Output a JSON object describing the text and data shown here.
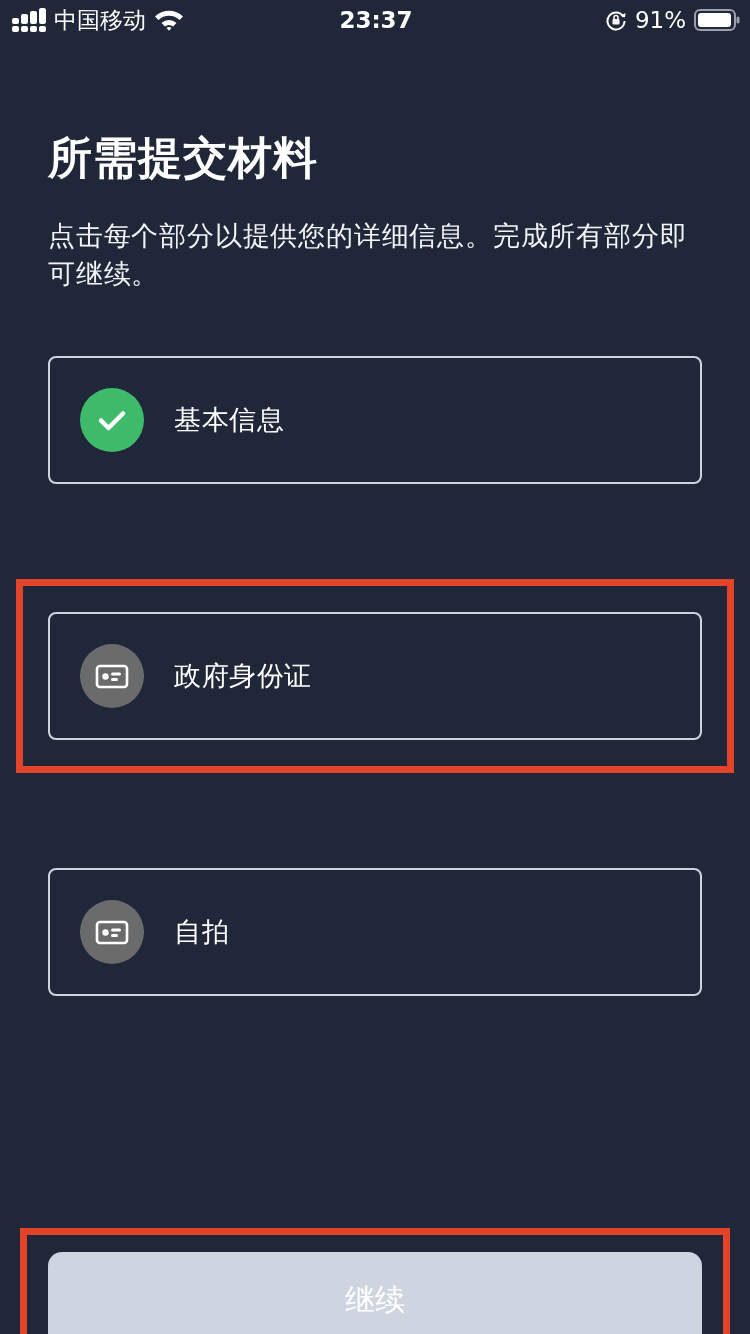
{
  "status_bar": {
    "carrier": "中国移动",
    "time": "23:37",
    "battery": "91%"
  },
  "title": "所需提交材料",
  "description": "点击每个部分以提供您的详细信息。完成所有部分即可继续。",
  "sections": [
    {
      "label": "基本信息",
      "completed": true,
      "highlighted": false
    },
    {
      "label": "政府身份证",
      "completed": false,
      "highlighted": true
    },
    {
      "label": "自拍",
      "completed": false,
      "highlighted": false
    }
  ],
  "continue_button": {
    "label": "继续",
    "disabled": true,
    "highlighted": true
  }
}
